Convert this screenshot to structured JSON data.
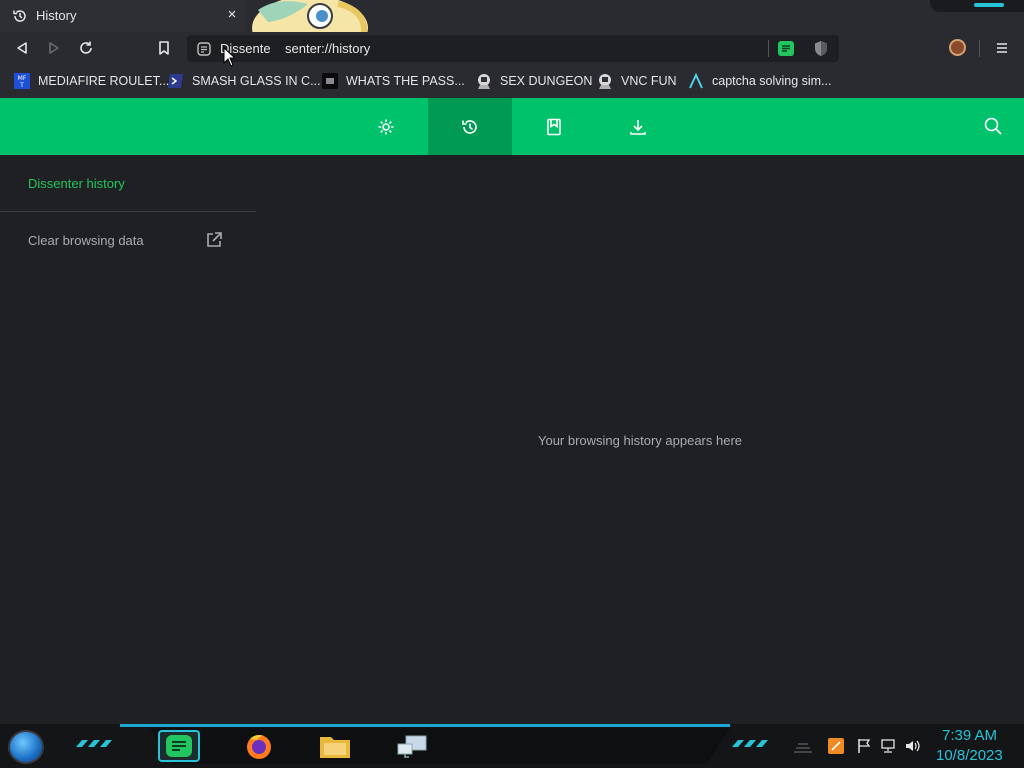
{
  "tab": {
    "title": "History",
    "close_glyph": "×",
    "icon": "history-icon"
  },
  "toolbar": {
    "back_icon": "back-icon",
    "forward_icon": "forward-icon",
    "reload_icon": "reload-icon",
    "bookmark_icon": "bookmark-icon",
    "url_display": "Dissente    senter://history",
    "menu_icon": "hamburger-menu-icon"
  },
  "bookmarks": [
    {
      "label": "MEDIAFIRE ROULET...",
      "icon": "mediafire-icon"
    },
    {
      "label": "SMASH GLASS IN C...",
      "icon": "powershell-icon"
    },
    {
      "label": "WHATS THE PASS...",
      "icon": "terminal-icon"
    },
    {
      "label": "SEX DUNGEON",
      "icon": "badge-icon"
    },
    {
      "label": "VNC FUN",
      "icon": "badge-icon"
    },
    {
      "label": "captcha solving sim...",
      "icon": "lambda-icon"
    }
  ],
  "header": {
    "nav": [
      {
        "id": "settings",
        "icon": "gear-icon",
        "active": false
      },
      {
        "id": "history",
        "icon": "history-icon",
        "active": true
      },
      {
        "id": "bookmarks",
        "icon": "bookmark-icon",
        "active": false
      },
      {
        "id": "downloads",
        "icon": "download-icon",
        "active": false
      }
    ],
    "search_icon": "search-icon"
  },
  "sidebar": {
    "heading": "Dissenter history",
    "clear_label": "Clear browsing data"
  },
  "main": {
    "empty_message": "Your browsing history appears here"
  },
  "taskbar": {
    "time": "7:39 AM",
    "date": "10/8/2023"
  },
  "colors": {
    "accent_green": "#00c26b",
    "accent_green_active": "#009a55",
    "link_green": "#22c55e",
    "clock_cyan": "#27c4d8",
    "page_bg": "#1f2024"
  }
}
